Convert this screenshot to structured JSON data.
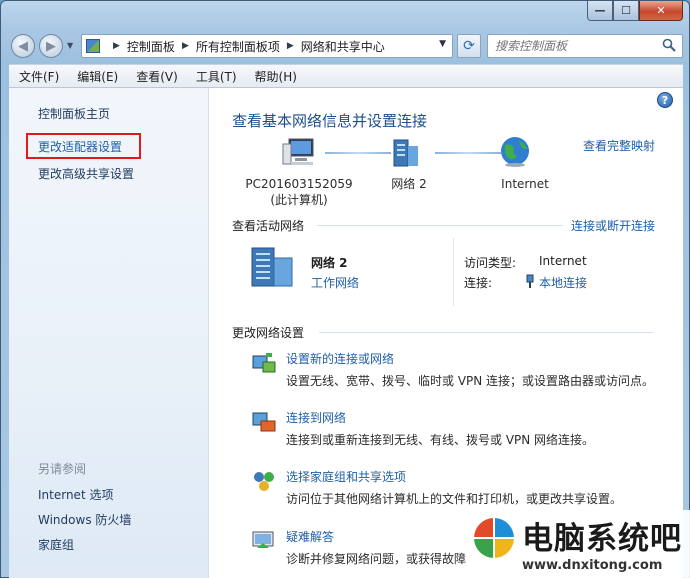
{
  "window": {
    "caption_buttons": {
      "minimize": "—",
      "maximize": "☐",
      "close": "✕"
    }
  },
  "address_bar": {
    "crumbs": [
      "控制面板",
      "所有控制面板项",
      "网络和共享中心"
    ],
    "search_placeholder": "搜索控制面板"
  },
  "menu": [
    "文件(F)",
    "编辑(E)",
    "查看(V)",
    "工具(T)",
    "帮助(H)"
  ],
  "sidebar": {
    "home": "控制面板主页",
    "adapter_settings": "更改适配器设置",
    "advanced_sharing": "更改高级共享设置",
    "see_also_title": "另请参阅",
    "see_also": [
      "Internet 选项",
      "Windows 防火墙",
      "家庭组"
    ]
  },
  "main": {
    "help_icon": "?",
    "title": "查看基本网络信息并设置连接",
    "full_map": "查看完整映射",
    "map_nodes": {
      "computer_line1": "PC201603152059",
      "computer_line2": "(此计算机)",
      "network": "网络  2",
      "internet": "Internet"
    },
    "active_networks_title": "查看活动网络",
    "connect_disconnect": "连接或断开连接",
    "active_network": {
      "name": "网络  2",
      "type": "工作网络",
      "access_type_label": "访问类型:",
      "access_type_value": "Internet",
      "connection_label": "连接:",
      "connection_value": "本地连接"
    },
    "change_settings_title": "更改网络设置",
    "tasks": [
      {
        "link": "设置新的连接或网络",
        "desc": "设置无线、宽带、拨号、临时或 VPN 连接；或设置路由器或访问点。"
      },
      {
        "link": "连接到网络",
        "desc": "连接到或重新连接到无线、有线、拨号或 VPN 网络连接。"
      },
      {
        "link": "选择家庭组和共享选项",
        "desc": "访问位于其他网络计算机上的文件和打印机，或更改共享设置。"
      },
      {
        "link": "疑难解答",
        "desc": "诊断并修复网络问题，或获得故障"
      }
    ]
  },
  "watermark": {
    "name": "电脑系统吧",
    "url": "www.dnxitong.com"
  }
}
